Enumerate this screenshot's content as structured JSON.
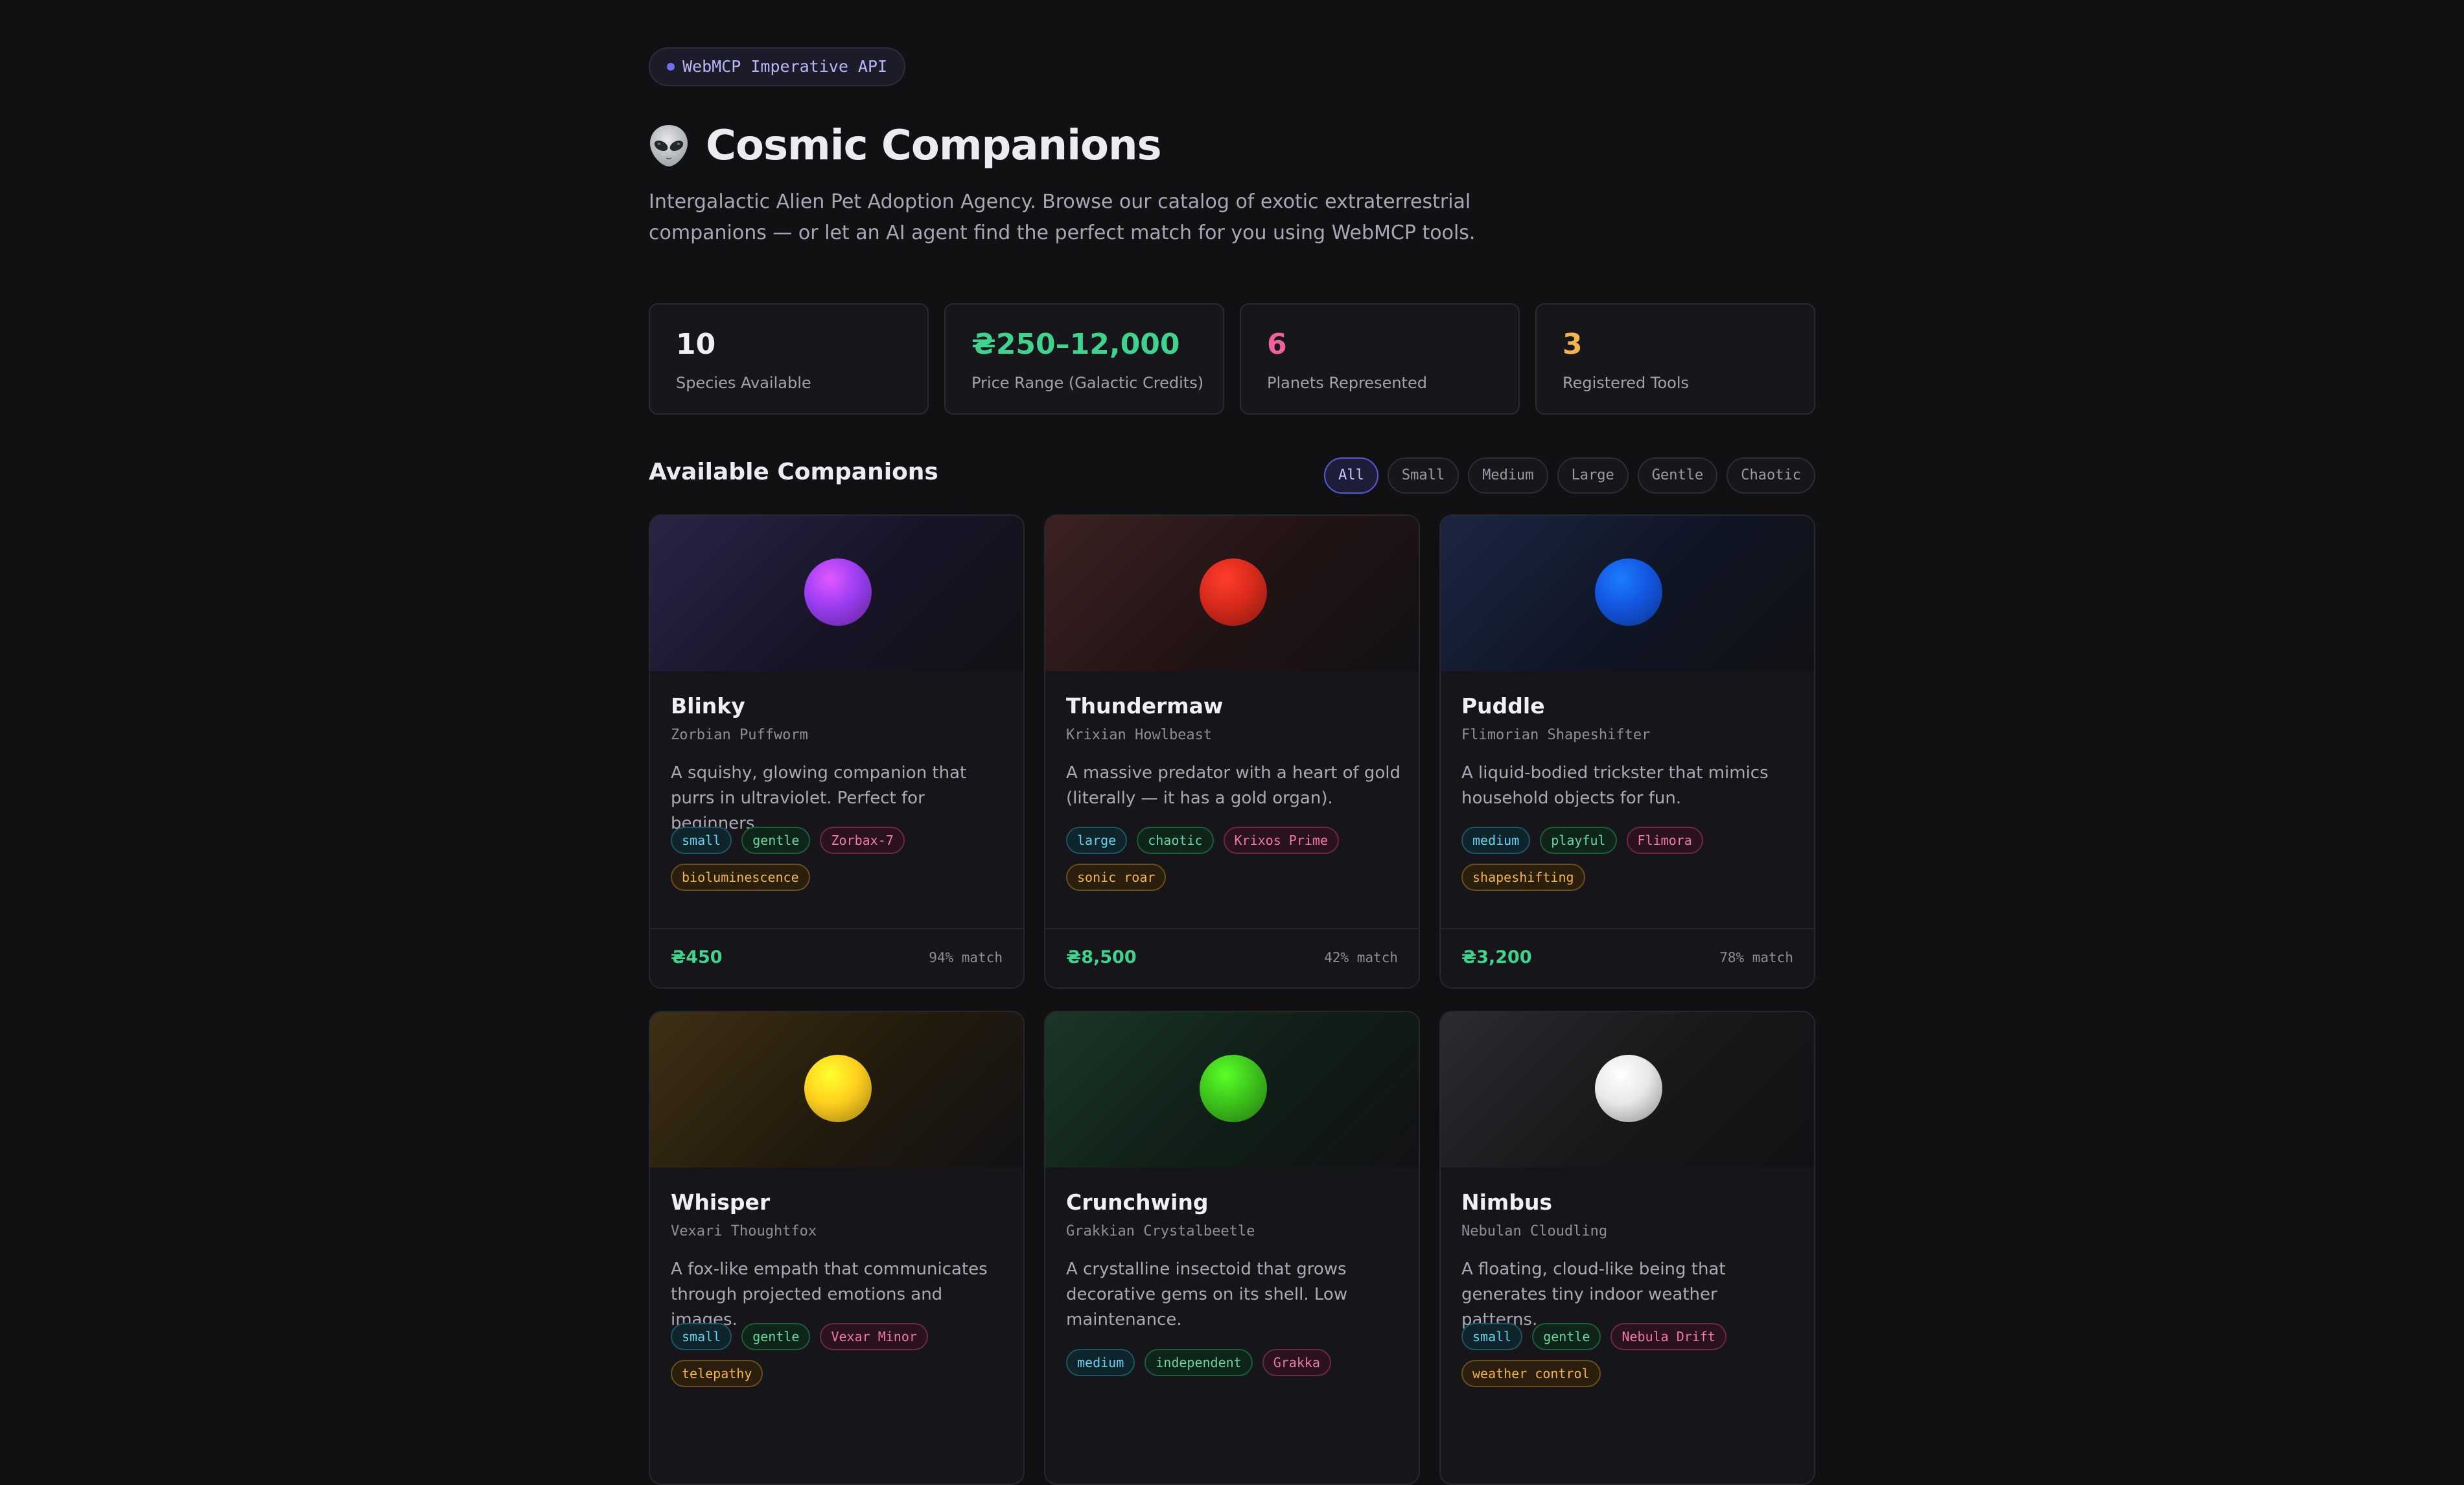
{
  "header": {
    "badge": "WebMCP Imperative API",
    "title": "Cosmic Companions",
    "subtitle": "Intergalactic Alien Pet Adoption Agency. Browse our catalog of exotic extraterrestrial companions — or let an AI agent find the perfect match for you using WebMCP tools."
  },
  "stats": [
    {
      "value": "10",
      "label": "Species Available",
      "color": "#f0f0f4"
    },
    {
      "value": "₴250–12,000",
      "label": "Price Range (Galactic Credits)",
      "color": "#40d38e"
    },
    {
      "value": "6",
      "label": "Planets Represented",
      "color": "#f0609b"
    },
    {
      "value": "3",
      "label": "Registered Tools",
      "color": "#f2b44d"
    }
  ],
  "catalog": {
    "title": "Available Companions",
    "filters": [
      "All",
      "Small",
      "Medium",
      "Large",
      "Gentle",
      "Chaotic"
    ],
    "active_filter": "All"
  },
  "pets": [
    {
      "name": "Blinky",
      "species": "Zorbian Puffworm",
      "description": "A squishy, glowing companion that purrs in ultraviolet. Perfect for beginners.",
      "tags": {
        "size": "small",
        "temperament": "gentle",
        "planet": "Zorbax-7",
        "ability": "bioluminescence"
      },
      "price": "₴450",
      "match": "94% match",
      "orb_color": "#9b3df2",
      "hero_color": "#2a2446"
    },
    {
      "name": "Thundermaw",
      "species": "Krixian Howlbeast",
      "description": "A massive predator with a heart of gold (literally — it has a gold organ).",
      "tags": {
        "size": "large",
        "temperament": "chaotic",
        "planet": "Krixos Prime",
        "ability": "sonic roar"
      },
      "price": "₴8,500",
      "match": "42% match",
      "orb_color": "#d82a1c",
      "hero_color": "#3c2223"
    },
    {
      "name": "Puddle",
      "species": "Flimorian Shapeshifter",
      "description": "A liquid-bodied trickster that mimics household objects for fun.",
      "tags": {
        "size": "medium",
        "temperament": "playful",
        "planet": "Flimora",
        "ability": "shapeshifting"
      },
      "price": "₴3,200",
      "match": "78% match",
      "orb_color": "#1356e0",
      "hero_color": "#1b2642"
    },
    {
      "name": "Whisper",
      "species": "Vexari Thoughtfox",
      "description": "A fox-like empath that communicates through projected emotions and images.",
      "tags": {
        "size": "small",
        "temperament": "gentle",
        "planet": "Vexar Minor",
        "ability": "telepathy"
      },
      "price": "",
      "match": "",
      "orb_color": "#ffcf1f",
      "hero_color": "#3e3016"
    },
    {
      "name": "Crunchwing",
      "species": "Grakkian Crystalbeetle",
      "description": "A crystalline insectoid that grows decorative gems on its shell. Low maintenance.",
      "tags": {
        "size": "medium",
        "temperament": "independent",
        "planet": "Grakka",
        "ability": ""
      },
      "price": "",
      "match": "",
      "orb_color": "#3ec41c",
      "hero_color": "#1c3628"
    },
    {
      "name": "Nimbus",
      "species": "Nebulan Cloudling",
      "description": "A floating, cloud-like being that generates tiny indoor weather patterns.",
      "tags": {
        "size": "small",
        "temperament": "gentle",
        "planet": "Nebula Drift",
        "ability": "weather control"
      },
      "price": "",
      "match": "",
      "orb_color": "#e8e8e8",
      "hero_color": "#2b2b30"
    }
  ]
}
